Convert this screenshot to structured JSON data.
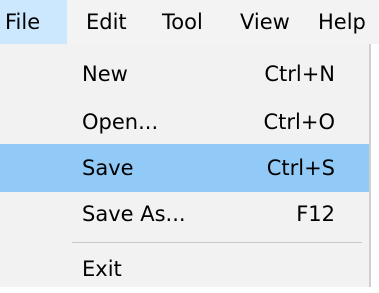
{
  "menubar": {
    "items": [
      {
        "label": "File"
      },
      {
        "label": "Edit"
      },
      {
        "label": "Tool"
      },
      {
        "label": "View"
      },
      {
        "label": "Help"
      }
    ]
  },
  "file_menu": {
    "items": [
      {
        "label": "New",
        "shortcut": "Ctrl+N"
      },
      {
        "label": "Open...",
        "shortcut": "Ctrl+O"
      },
      {
        "label": "Save",
        "shortcut": "Ctrl+S",
        "highlighted": true
      },
      {
        "label": "Save As...",
        "shortcut": "F12"
      },
      {
        "label": "Exit",
        "shortcut": ""
      }
    ]
  },
  "colors": {
    "menubar_bg": "#f3f3f3",
    "active_menu_bg": "#cce8ff",
    "dropdown_bg": "#f2f2f2",
    "highlight_bg": "#91c9f7",
    "separator": "#c8c8c8"
  }
}
